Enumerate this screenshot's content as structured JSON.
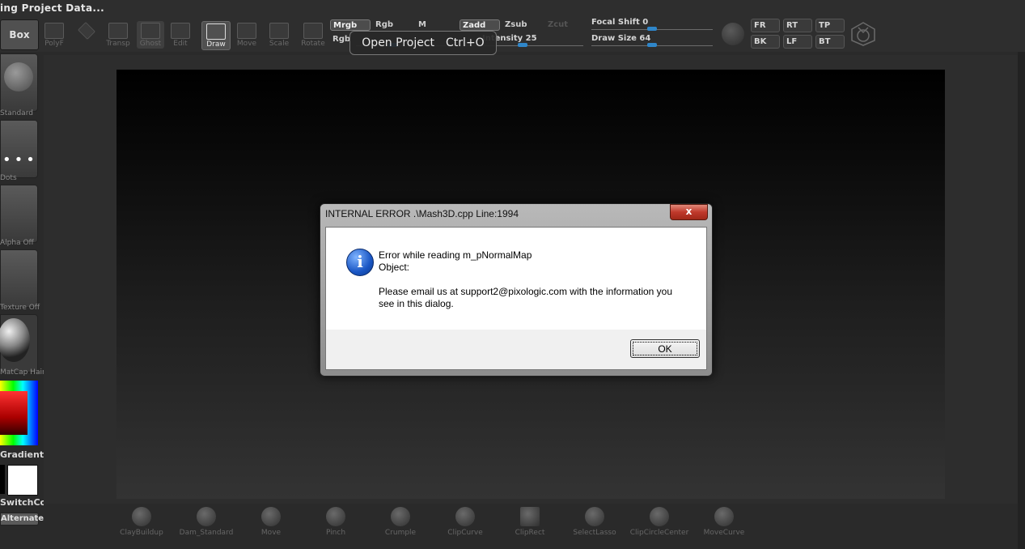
{
  "window": {
    "title": "ing Project Data..."
  },
  "toolbar": {
    "box_label": "Box",
    "tools": [
      {
        "label": "PolyF"
      },
      {
        "label": ""
      },
      {
        "label": "Transp"
      },
      {
        "label": "Ghost"
      },
      {
        "label": "Edit"
      },
      {
        "label": "Draw"
      },
      {
        "label": "Move"
      },
      {
        "label": "Scale"
      },
      {
        "label": "Rotate"
      }
    ],
    "modes_row1": [
      "Mrgb",
      "Rgb",
      "M",
      "Zadd",
      "Zsub",
      "Zcut"
    ],
    "rgb_intensity_label": "Rgb",
    "z_intensity": "Intensity 25",
    "focal_shift": "Focal Shift 0",
    "draw_size": "Draw Size 64",
    "view_buttons": [
      "FR",
      "RT",
      "TP",
      "BK",
      "LF",
      "BT"
    ]
  },
  "tooltip": {
    "label": "Open Project",
    "shortcut": "Ctrl+O"
  },
  "left_panel": {
    "brush_label": "Standard",
    "stroke_label": "Dots",
    "alpha_label": "Alpha Off",
    "texture_label": "Texture Off",
    "material_label": "MatCap Hair",
    "gradient_label": "Gradient",
    "switch_color_label": "SwitchColor",
    "alternate_label": "Alternate"
  },
  "brush_shelf": [
    "ClayBuildup",
    "Dam_Standard",
    "Move",
    "Pinch",
    "Crumple",
    "ClipCurve",
    "ClipRect",
    "SelectLasso",
    "ClipCircleCenter",
    "MoveCurve"
  ],
  "dialog": {
    "title": "INTERNAL ERROR .\\Mash3D.cpp  Line:1994",
    "close_label": "x",
    "line1": "Error while reading m_pNormalMap",
    "line2": "Object:",
    "line3": "Please email us at support2@pixologic.com with the information you",
    "line4": "see in this dialog.",
    "ok_label": "OK"
  },
  "colors": {
    "accent_blue": "#2f86c9",
    "close_red": "#c0392b",
    "dialog_bg": "#ffffff"
  }
}
